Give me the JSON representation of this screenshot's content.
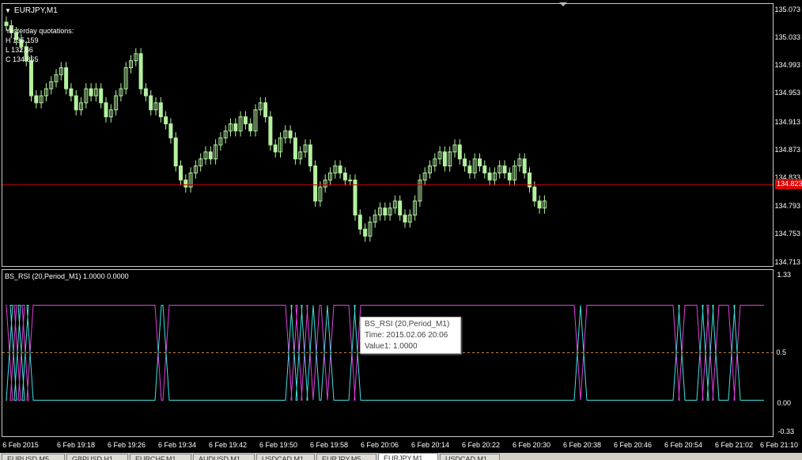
{
  "window": {
    "symbol_title": "EURJPY,M1",
    "yesterday": {
      "heading": "Yesterday quotations:",
      "high": "H 135.159",
      "low": "L 132.66",
      "close": "C 134.865"
    },
    "indicator_title": "BS_RSI (20,Period_M1) 1.0000 0.0000",
    "current_price": "134.823"
  },
  "price_axis": {
    "ticks": [
      "135.073",
      "135.033",
      "134.993",
      "134.953",
      "134.913",
      "134.873",
      "134.833",
      "134.793",
      "134.753",
      "134.713"
    ]
  },
  "indicator_axis": {
    "ticks": [
      "1.33",
      "0.5",
      "0.00",
      "-0.33"
    ]
  },
  "time_axis": {
    "ticks": [
      "6 Feb 2015",
      "6 Feb 19:18",
      "6 Feb 19:26",
      "6 Feb 19:34",
      "6 Feb 19:42",
      "6 Feb 19:50",
      "6 Feb 19:58",
      "6 Feb 20:06",
      "6 Feb 20:14",
      "6 Feb 20:22",
      "6 Feb 20:30",
      "6 Feb 20:38",
      "6 Feb 20:46",
      "6 Feb 20:54",
      "6 Feb 21:02",
      "6 Feb 21:10"
    ]
  },
  "tooltip": {
    "line1": "BS_RSI (20,Period_M1)",
    "line2": "Time: 2015.02.06 20:06",
    "line3": "Value1: 1.0000"
  },
  "tabs": [
    "EURUSD,M5",
    "GBPUSD,H1",
    "EURCHF,M1",
    "AUDUSD,M1",
    "USDCAD,M1",
    "EURJPY,M5",
    "EURJPY,M1",
    "USDCAD,M1"
  ],
  "active_tab": "EURJPY,M1",
  "colors": {
    "candle": "#b4f0a0",
    "current_price_line": "#cc0000",
    "rsi_up": "#e040e0",
    "rsi_down": "#40e0e0",
    "midline": "#d08030"
  },
  "chart_data": {
    "type": "candlestick",
    "ylim": [
      134.713,
      135.073
    ],
    "closes": [
      135.05,
      135.04,
      135.03,
      135.02,
      135.0,
      134.95,
      134.94,
      134.95,
      134.96,
      134.97,
      134.98,
      134.99,
      134.96,
      134.95,
      134.93,
      134.94,
      134.96,
      134.95,
      134.96,
      134.94,
      134.92,
      134.93,
      134.95,
      134.96,
      134.99,
      135.0,
      135.01,
      134.96,
      134.95,
      134.93,
      134.94,
      134.92,
      134.91,
      134.89,
      134.85,
      134.83,
      134.82,
      134.84,
      134.85,
      134.86,
      134.87,
      134.86,
      134.88,
      134.89,
      134.9,
      134.91,
      134.9,
      134.92,
      134.91,
      134.9,
      134.93,
      134.94,
      134.92,
      134.88,
      134.87,
      134.89,
      134.9,
      134.89,
      134.86,
      134.87,
      134.88,
      134.85,
      134.8,
      134.82,
      134.83,
      134.84,
      134.85,
      134.84,
      134.83,
      134.83,
      134.78,
      134.76,
      134.75,
      134.77,
      134.78,
      134.79,
      134.78,
      134.79,
      134.8,
      134.78,
      134.77,
      134.78,
      134.8,
      134.83,
      134.84,
      134.85,
      134.86,
      134.87,
      134.85,
      134.87,
      134.88,
      134.86,
      134.85,
      134.84,
      134.86,
      134.85,
      134.84,
      134.83,
      134.84,
      134.85,
      134.84,
      134.83,
      134.85,
      134.86,
      134.84,
      134.82,
      134.8,
      134.79,
      134.8
    ]
  },
  "indicator_data": {
    "type": "line",
    "ylim": [
      -0.33,
      1.33
    ],
    "series_up": [
      1,
      1,
      0,
      1,
      0,
      1,
      1,
      1,
      1,
      1,
      1,
      1,
      1,
      1,
      1,
      1,
      1,
      1,
      1,
      1,
      1,
      1,
      1,
      1,
      1,
      1,
      1,
      1,
      1,
      1,
      1,
      1,
      1,
      1,
      1,
      1,
      1,
      1,
      1,
      1,
      1,
      1,
      1,
      1,
      1,
      1,
      1,
      1,
      1,
      1,
      1,
      1,
      1,
      1,
      1,
      1,
      1,
      1,
      1,
      1,
      1,
      1,
      1,
      1,
      1,
      1,
      1,
      1,
      1,
      1,
      1,
      1,
      1,
      1,
      1,
      1,
      1,
      1,
      1,
      1,
      1,
      1,
      1,
      1,
      1,
      1,
      1,
      1,
      1,
      1,
      1,
      1,
      1,
      1,
      1,
      1,
      1,
      1,
      1,
      1,
      1,
      1,
      1,
      1,
      1,
      1,
      1,
      1,
      1
    ]
  }
}
